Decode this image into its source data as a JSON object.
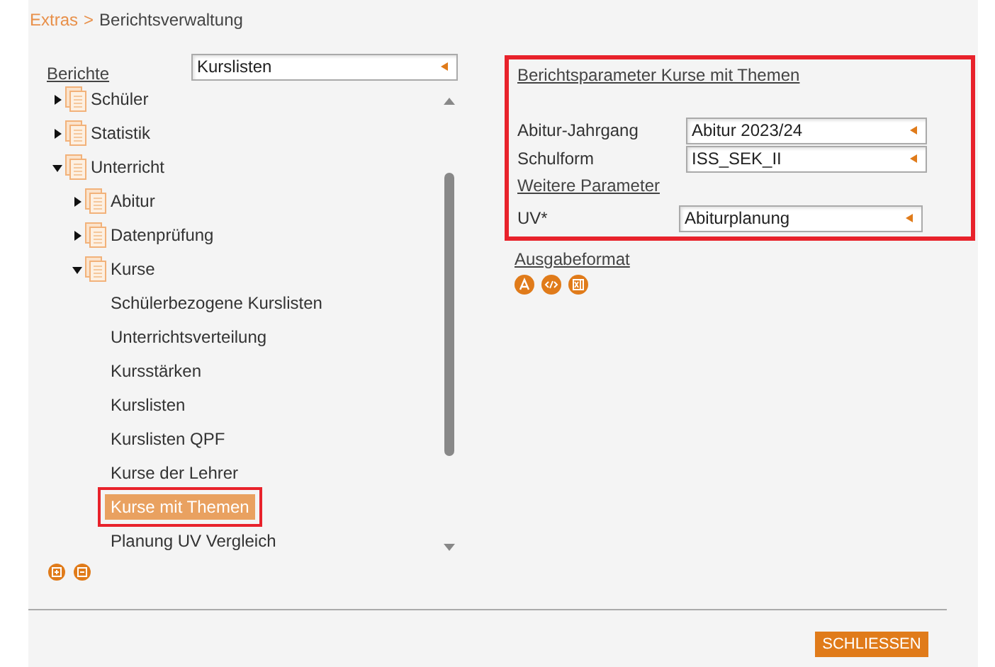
{
  "breadcrumb": {
    "root": "Extras",
    "separator": ">",
    "current": "Berichtsverwaltung"
  },
  "report_picker": {
    "label": "Berichte",
    "value": "Kurslisten"
  },
  "tree": [
    {
      "label": "Schüler",
      "expanded": false
    },
    {
      "label": "Statistik",
      "expanded": false
    },
    {
      "label": "Unterricht",
      "expanded": true,
      "children": [
        {
          "label": "Abitur",
          "expanded": false
        },
        {
          "label": "Datenprüfung",
          "expanded": false
        },
        {
          "label": "Kurse",
          "expanded": true,
          "children": [
            {
              "label": "Schülerbezogene Kurslisten",
              "selected": false
            },
            {
              "label": "Unterrichtsverteilung",
              "selected": false
            },
            {
              "label": "Kursstärken",
              "selected": false
            },
            {
              "label": "Kurslisten",
              "selected": false
            },
            {
              "label": "Kurslisten QPF",
              "selected": false
            },
            {
              "label": "Kurse der Lehrer",
              "selected": false
            },
            {
              "label": "Kurse mit Themen",
              "selected": true
            },
            {
              "label": "Planung UV Vergleich",
              "selected": false
            }
          ]
        }
      ]
    }
  ],
  "parameters": {
    "title": "Berichtsparameter Kurse mit Themen",
    "fields": [
      {
        "label": "Abitur-Jahrgang",
        "value": "Abitur 2023/24"
      },
      {
        "label": "Schulform",
        "value": "ISS_SEK_II"
      }
    ],
    "more_title": "Weitere Parameter",
    "extra_fields": [
      {
        "label": "UV*",
        "value": "Abiturplanung"
      }
    ]
  },
  "output": {
    "title": "Ausgabeformat"
  },
  "close_button": "SCHLIESSEN"
}
